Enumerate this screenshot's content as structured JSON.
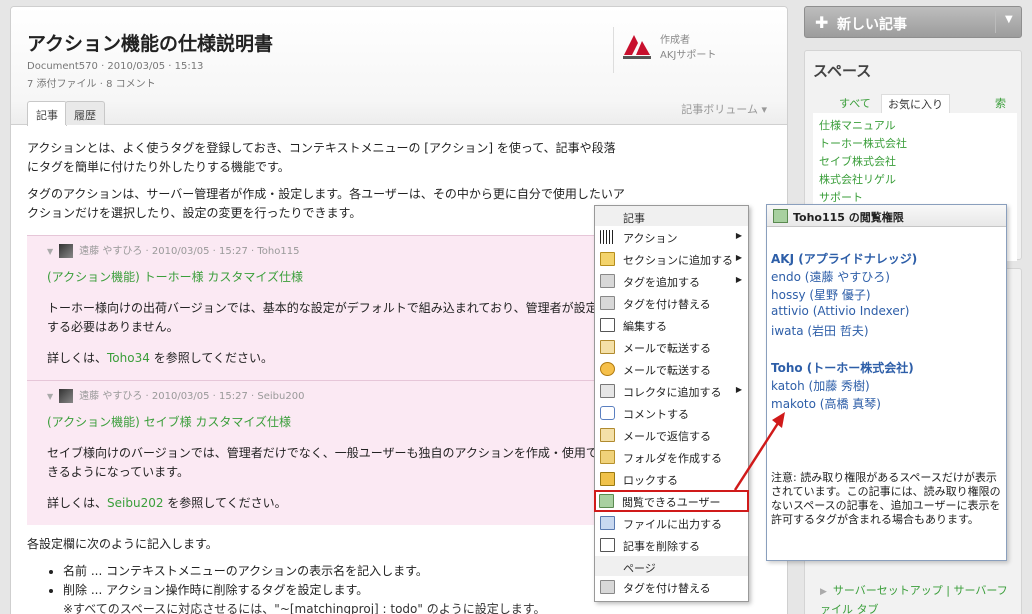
{
  "doc": {
    "title": "アクション機能の仕様説明書",
    "meta1": "Document570 · 2010/03/05 · 15:13",
    "meta2": "7 添付ファイル · 8 コメント",
    "author_label": "作成者",
    "author_name": "AKJサポート",
    "tabs": [
      "記事",
      "履歴"
    ],
    "volume_label": "記事ボリューム",
    "para1": "アクションとは、よく使うタグを登録しておき、コンテキストメニューの [アクション] を使って、記事や段落にタグを簡単に付けたり外したりする機能です。",
    "para2": "タグのアクションは、サーバー管理者が作成・設定します。各ユーザーは、その中から更に自分で使用したいアクションだけを選択したり、設定の変更を行ったりできます。",
    "comments": [
      {
        "head": "遠藤 やすひろ · 2010/03/05 · 15:27 · Toho115",
        "title": "(アクション機能) トーホー様 カスタマイズ仕様",
        "text": "トーホー様向けの出荷バージョンでは、基本的な設定がデフォルトで組み込まれており、管理者が設定する必要はありません。",
        "link_pre": "詳しくは、",
        "link": "Toho34",
        "link_post": " を参照してください。"
      },
      {
        "head": "遠藤 やすひろ · 2010/03/05 · 15:27 · Seibu200",
        "title": "(アクション機能) セイブ様 カスタマイズ仕様",
        "text": "セイブ様向けのバージョンでは、管理者だけでなく、一般ユーザーも独自のアクションを作成・使用できるようになっています。",
        "link_pre": "詳しくは、",
        "link": "Seibu202",
        "link_post": " を参照してください。"
      }
    ],
    "para3": "各設定欄に次のように記入します。",
    "bullets": [
      "名前 ... コンテキストメニューのアクションの表示名を記入します。",
      "削除 ... アクション操作時に削除するタグを設定します。"
    ],
    "subnote": "※すべてのスペースに対応させるには、\"~[matchingproj] : todo\" のように設定します。"
  },
  "sidebar": {
    "new_button": "新しい記事",
    "space_title": "スペース",
    "space_tabs": [
      "すべて",
      "お気に入り",
      "索引"
    ],
    "spaces": [
      "仕様マニュアル",
      "トーホー株式会社",
      "セイブ株式会社",
      "株式会社リゲル",
      "サポート"
    ],
    "link": "サーバーセットアップ | サーバーファイル タブ"
  },
  "context_menu": {
    "section_article": "記事",
    "items": [
      {
        "label": "アクション",
        "icon": "barcode-icon",
        "submenu": true
      },
      {
        "label": "セクションに追加する",
        "icon": "section-icon",
        "submenu": true
      },
      {
        "label": "タグを追加する",
        "icon": "tag-icon",
        "submenu": true
      },
      {
        "label": "タグを付け替える",
        "icon": "tag-icon",
        "submenu": false
      },
      {
        "label": "編集する",
        "icon": "edit-icon",
        "submenu": false
      },
      {
        "label": "メールで転送する",
        "icon": "mail-icon",
        "submenu": false
      },
      {
        "label": "メールで転送する",
        "icon": "clock-icon",
        "submenu": false
      },
      {
        "label": "コレクタに追加する",
        "icon": "collector-icon",
        "submenu": true
      },
      {
        "label": "コメントする",
        "icon": "comment-icon",
        "submenu": false
      },
      {
        "label": "メールで返信する",
        "icon": "mail-icon",
        "submenu": false
      },
      {
        "label": "フォルダを作成する",
        "icon": "folder-icon",
        "submenu": false
      },
      {
        "label": "ロックする",
        "icon": "lock-icon",
        "submenu": false
      },
      {
        "label": "閲覧できるユーザー",
        "icon": "users-icon",
        "submenu": false
      },
      {
        "label": "ファイルに出力する",
        "icon": "file-export-icon",
        "submenu": false
      },
      {
        "label": "記事を削除する",
        "icon": "delete-icon",
        "submenu": false
      }
    ],
    "section_page": "ページ",
    "page_items": [
      {
        "label": "タグを付け替える",
        "icon": "tag-icon"
      }
    ]
  },
  "popup": {
    "title": "Toho115 の閲覧権限",
    "groups": [
      {
        "name": "AKJ (アプライドナレッジ)",
        "users": [
          "endo (遠藤 やすひろ)",
          "hossy (星野 優子)",
          "attivio (Attivio Indexer)",
          "iwata (岩田 哲夫)"
        ]
      },
      {
        "name": "Toho (トーホー株式会社)",
        "users": [
          "katoh (加藤 秀樹)",
          "makoto (高橋 真琴)"
        ]
      }
    ],
    "note": "注意: 読み取り権限があるスペースだけが表示されています。この記事には、読み取り権限のないスペースの記事を、追加ユーザーに表示を許可するタグが含まれる場合もあります。"
  },
  "colors": {
    "accent_green": "#3a9e3a",
    "link_blue": "#2d5ea8",
    "highlight_red": "#d01a1a",
    "comment_bg": "#fbe9f3"
  }
}
